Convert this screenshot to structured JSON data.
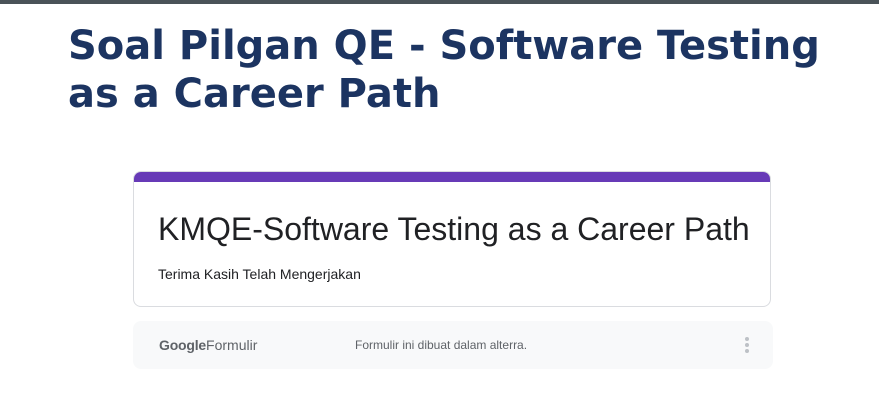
{
  "page": {
    "title": "Soal Pilgan QE - Software Testing as a Career Path"
  },
  "form": {
    "title": "KMQE-Software Testing as a Career Path",
    "message": "Terima Kasih Telah Mengerjakan",
    "accent_color": "#673ab7"
  },
  "footer": {
    "logo_google": "Google",
    "logo_product": "Formulir",
    "note": "Formulir ini dibuat dalam alterra.",
    "more_icon": "more-vert-icon"
  },
  "colors": {
    "title": "#1c3461",
    "top_bar": "#4a5358"
  }
}
